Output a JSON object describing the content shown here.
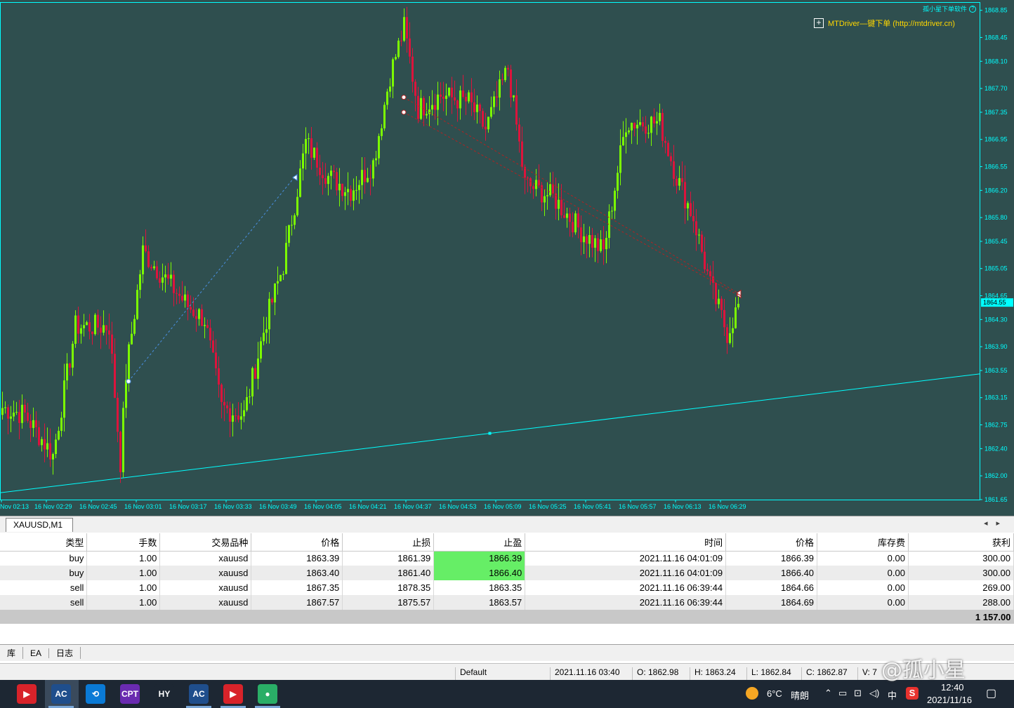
{
  "chart": {
    "badge_label": "MTDriver—键下单 (http://mtdriver.cn)",
    "corner_brand": "孤小星下单软件",
    "colors": {
      "background": "#2f4f4f",
      "bull": "#7cfc00",
      "bear": "#dc143c",
      "axis": "#00ffff"
    },
    "price_ticks": [
      "1868.85",
      "1868.45",
      "1868.10",
      "1867.70",
      "1867.35",
      "1866.95",
      "1866.55",
      "1866.20",
      "1865.80",
      "1865.45",
      "1865.05",
      "1864.65",
      "1864.30",
      "1863.90",
      "1863.55",
      "1863.15",
      "1862.75",
      "1862.40",
      "1862.00",
      "1861.65"
    ],
    "current_price": "1864.55",
    "time_ticks": [
      "Nov 02:13",
      "16 Nov 02:29",
      "16 Nov 02:45",
      "16 Nov 03:01",
      "16 Nov 03:17",
      "16 Nov 03:33",
      "16 Nov 03:49",
      "16 Nov 04:05",
      "16 Nov 04:21",
      "16 Nov 04:37",
      "16 Nov 04:53",
      "16 Nov 05:09",
      "16 Nov 05:25",
      "16 Nov 05:41",
      "16 Nov 05:57",
      "16 Nov 06:13",
      "16 Nov 06:29"
    ]
  },
  "chart_data": {
    "type": "candlestick",
    "symbol": "XAUUSD",
    "timeframe": "M1",
    "ylim": [
      1861.65,
      1868.95
    ],
    "waypoints": [
      {
        "t": 0,
        "p": 1863.0
      },
      {
        "t": 8,
        "p": 1862.9
      },
      {
        "t": 18,
        "p": 1862.3
      },
      {
        "t": 26,
        "p": 1864.2
      },
      {
        "t": 38,
        "p": 1864.2
      },
      {
        "t": 42,
        "p": 1862.2
      },
      {
        "t": 44,
        "p": 1863.5
      },
      {
        "t": 50,
        "p": 1865.3
      },
      {
        "t": 56,
        "p": 1865.0
      },
      {
        "t": 66,
        "p": 1864.5
      },
      {
        "t": 72,
        "p": 1864.3
      },
      {
        "t": 78,
        "p": 1863.0
      },
      {
        "t": 86,
        "p": 1862.9
      },
      {
        "t": 94,
        "p": 1864.3
      },
      {
        "t": 100,
        "p": 1865.1
      },
      {
        "t": 108,
        "p": 1866.9
      },
      {
        "t": 116,
        "p": 1866.4
      },
      {
        "t": 124,
        "p": 1866.2
      },
      {
        "t": 132,
        "p": 1866.6
      },
      {
        "t": 138,
        "p": 1867.9
      },
      {
        "t": 143,
        "p": 1868.6
      },
      {
        "t": 148,
        "p": 1867.4
      },
      {
        "t": 156,
        "p": 1867.6
      },
      {
        "t": 166,
        "p": 1867.5
      },
      {
        "t": 172,
        "p": 1867.1
      },
      {
        "t": 180,
        "p": 1868.0
      },
      {
        "t": 186,
        "p": 1866.3
      },
      {
        "t": 196,
        "p": 1866.1
      },
      {
        "t": 206,
        "p": 1865.6
      },
      {
        "t": 214,
        "p": 1865.3
      },
      {
        "t": 222,
        "p": 1867.2
      },
      {
        "t": 234,
        "p": 1867.2
      },
      {
        "t": 240,
        "p": 1866.4
      },
      {
        "t": 246,
        "p": 1865.8
      },
      {
        "t": 252,
        "p": 1864.8
      },
      {
        "t": 258,
        "p": 1864.1
      },
      {
        "t": 262,
        "p": 1864.5
      }
    ],
    "orders_on_chart": [
      {
        "entry": 1863.39,
        "entry_index": 45,
        "exit": 1866.39,
        "exit_index": 104
      },
      {
        "entry": 1867.35,
        "entry_index": 143,
        "exit": 1864.66,
        "exit_index": 262
      },
      {
        "entry": 1867.57,
        "entry_index": 143,
        "exit": 1864.69,
        "exit_index": 262
      }
    ],
    "trendline": {
      "from_price": 1861.75,
      "to_price": 1863.5,
      "midpoint_marker": true
    }
  },
  "tabs": {
    "symbol_tab": "XAUUSD,M1",
    "scroll_left": "◂",
    "scroll_right": "▸"
  },
  "orders": {
    "columns": [
      "类型",
      "手数",
      "交易品种",
      "价格",
      "止损",
      "止盈",
      "时间",
      "价格",
      "库存费",
      "获利"
    ],
    "rows": [
      [
        "buy",
        "1.00",
        "xauusd",
        "1863.39",
        "1861.39",
        "1866.39",
        "2021.11.16 04:01:09",
        "1866.39",
        "0.00",
        "300.00"
      ],
      [
        "buy",
        "1.00",
        "xauusd",
        "1863.40",
        "1861.40",
        "1866.40",
        "2021.11.16 04:01:09",
        "1866.40",
        "0.00",
        "300.00"
      ],
      [
        "sell",
        "1.00",
        "xauusd",
        "1867.35",
        "1878.35",
        "1863.35",
        "2021.11.16 06:39:44",
        "1864.66",
        "0.00",
        "269.00"
      ],
      [
        "sell",
        "1.00",
        "xauusd",
        "1867.57",
        "1875.57",
        "1863.57",
        "2021.11.16 06:39:44",
        "1864.69",
        "0.00",
        "288.00"
      ]
    ],
    "highlighted_tp_rows": [
      0,
      1
    ],
    "total": "1 157.00"
  },
  "panel_tabs": [
    "库",
    "EA",
    "日志"
  ],
  "status": {
    "profile": "Default",
    "datetime": "2021.11.16 03:40",
    "open": "O: 1862.98",
    "high": "H: 1863.24",
    "low": "L: 1862.84",
    "close": "C: 1862.87",
    "volume": "V: 7"
  },
  "taskbar": {
    "apps": [
      {
        "name": "pdf-app-icon",
        "label": "▶",
        "color": "#d8232a"
      },
      {
        "name": "ac-app-icon",
        "label": "AC",
        "color": "#1f4e8c"
      },
      {
        "name": "link-app-icon",
        "label": "⟲",
        "color": "#0a7ad6"
      },
      {
        "name": "cpt-app-icon",
        "label": "CPT",
        "color": "#6a2bb0"
      },
      {
        "name": "hy-app-icon",
        "label": "HY",
        "color": "#1d2733"
      },
      {
        "name": "ac2-app-icon",
        "label": "AC",
        "color": "#1f4e8c"
      },
      {
        "name": "pdf2-app-icon",
        "label": "▶",
        "color": "#d8232a"
      },
      {
        "name": "wechat-app-icon",
        "label": "●",
        "color": "#2aae67"
      }
    ],
    "weather_temp": "6°C",
    "weather_text": "晴朗",
    "ime": "中",
    "time": "12:40",
    "date": "2021/11/16"
  },
  "watermark": "@孤小星"
}
